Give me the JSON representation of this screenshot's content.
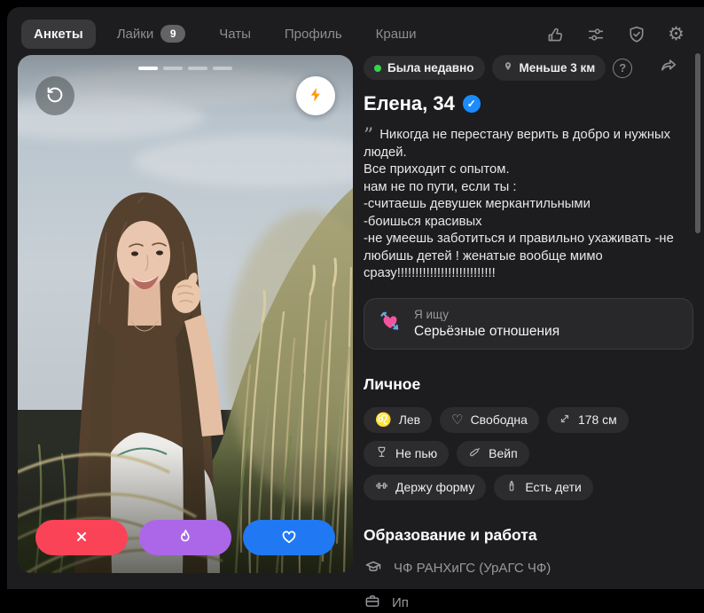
{
  "nav": {
    "items": [
      {
        "label": "Анкеты",
        "active": true
      },
      {
        "label": "Лайки",
        "badge": "9"
      },
      {
        "label": "Чаты"
      },
      {
        "label": "Профиль"
      },
      {
        "label": "Краши"
      }
    ]
  },
  "header": {
    "icons": [
      "thumbs-up-icon",
      "filters-icon",
      "shield-check-icon",
      "settings-gear-icon"
    ],
    "gear_glyph": "⚙"
  },
  "photo_card": {
    "photos_total": 4,
    "active_photo_index": 1,
    "buttons": [
      "rewind",
      "boost",
      "dislike",
      "superlike-fire",
      "like"
    ]
  },
  "profile": {
    "status_badges": [
      {
        "label": "Была недавно",
        "indicator": "green-dot",
        "color": "#32d74b"
      },
      {
        "label": "Меньше 3 км",
        "indicator": "location-pin-icon"
      }
    ],
    "help_glyph": "?",
    "name_age": "Елена, 34",
    "verified_glyph": "✓",
    "quote_glyph": "”",
    "bio": "Никогда не перестану верить в добро и нужных людей.\nВсе приходит с опытом.\nнам не по пути, если ты :\n-считаешь девушек меркантильными\n-боишься красивых\n-не умеешь заботиться и правильно ухаживать -не любишь детей ! женатые вообще мимо сразу!!!!!!!!!!!!!!!!!!!!!!!!!!!",
    "looking_for": {
      "icon": "heart-with-arrow",
      "label": "Я ищу",
      "value": "Серьёзные отношения"
    },
    "personal": {
      "title": "Личное",
      "chips": [
        {
          "icon": "leo-zodiac",
          "glyph": "♌",
          "label": "Лев"
        },
        {
          "icon": "heart-outline",
          "glyph": "♡",
          "label": "Свободна"
        },
        {
          "icon": "height-arrows",
          "label": "178 см"
        },
        {
          "icon": "wine-glass",
          "label": "Не пью"
        },
        {
          "icon": "vape-pen",
          "label": "Вейп"
        },
        {
          "icon": "dumbbell",
          "label": "Держу форму"
        },
        {
          "icon": "baby-bottle",
          "label": "Есть дети"
        }
      ]
    },
    "education_work": {
      "title": "Образование и работа",
      "items": [
        {
          "icon": "graduation-cap",
          "label": "ЧФ РАНХиГС (УрАГС ЧФ)"
        },
        {
          "icon": "briefcase",
          "label": "Ип"
        }
      ]
    }
  },
  "colors": {
    "accent_like": "#2079f3",
    "accent_fire": "#ab67e8",
    "accent_dislike": "#fb4358",
    "boost_bolt": "#ff9800",
    "verified_blue": "#1a8cff",
    "online_green": "#32d74b",
    "panel_bg": "#1d1d1f",
    "chip_bg": "#2c2c2e"
  }
}
